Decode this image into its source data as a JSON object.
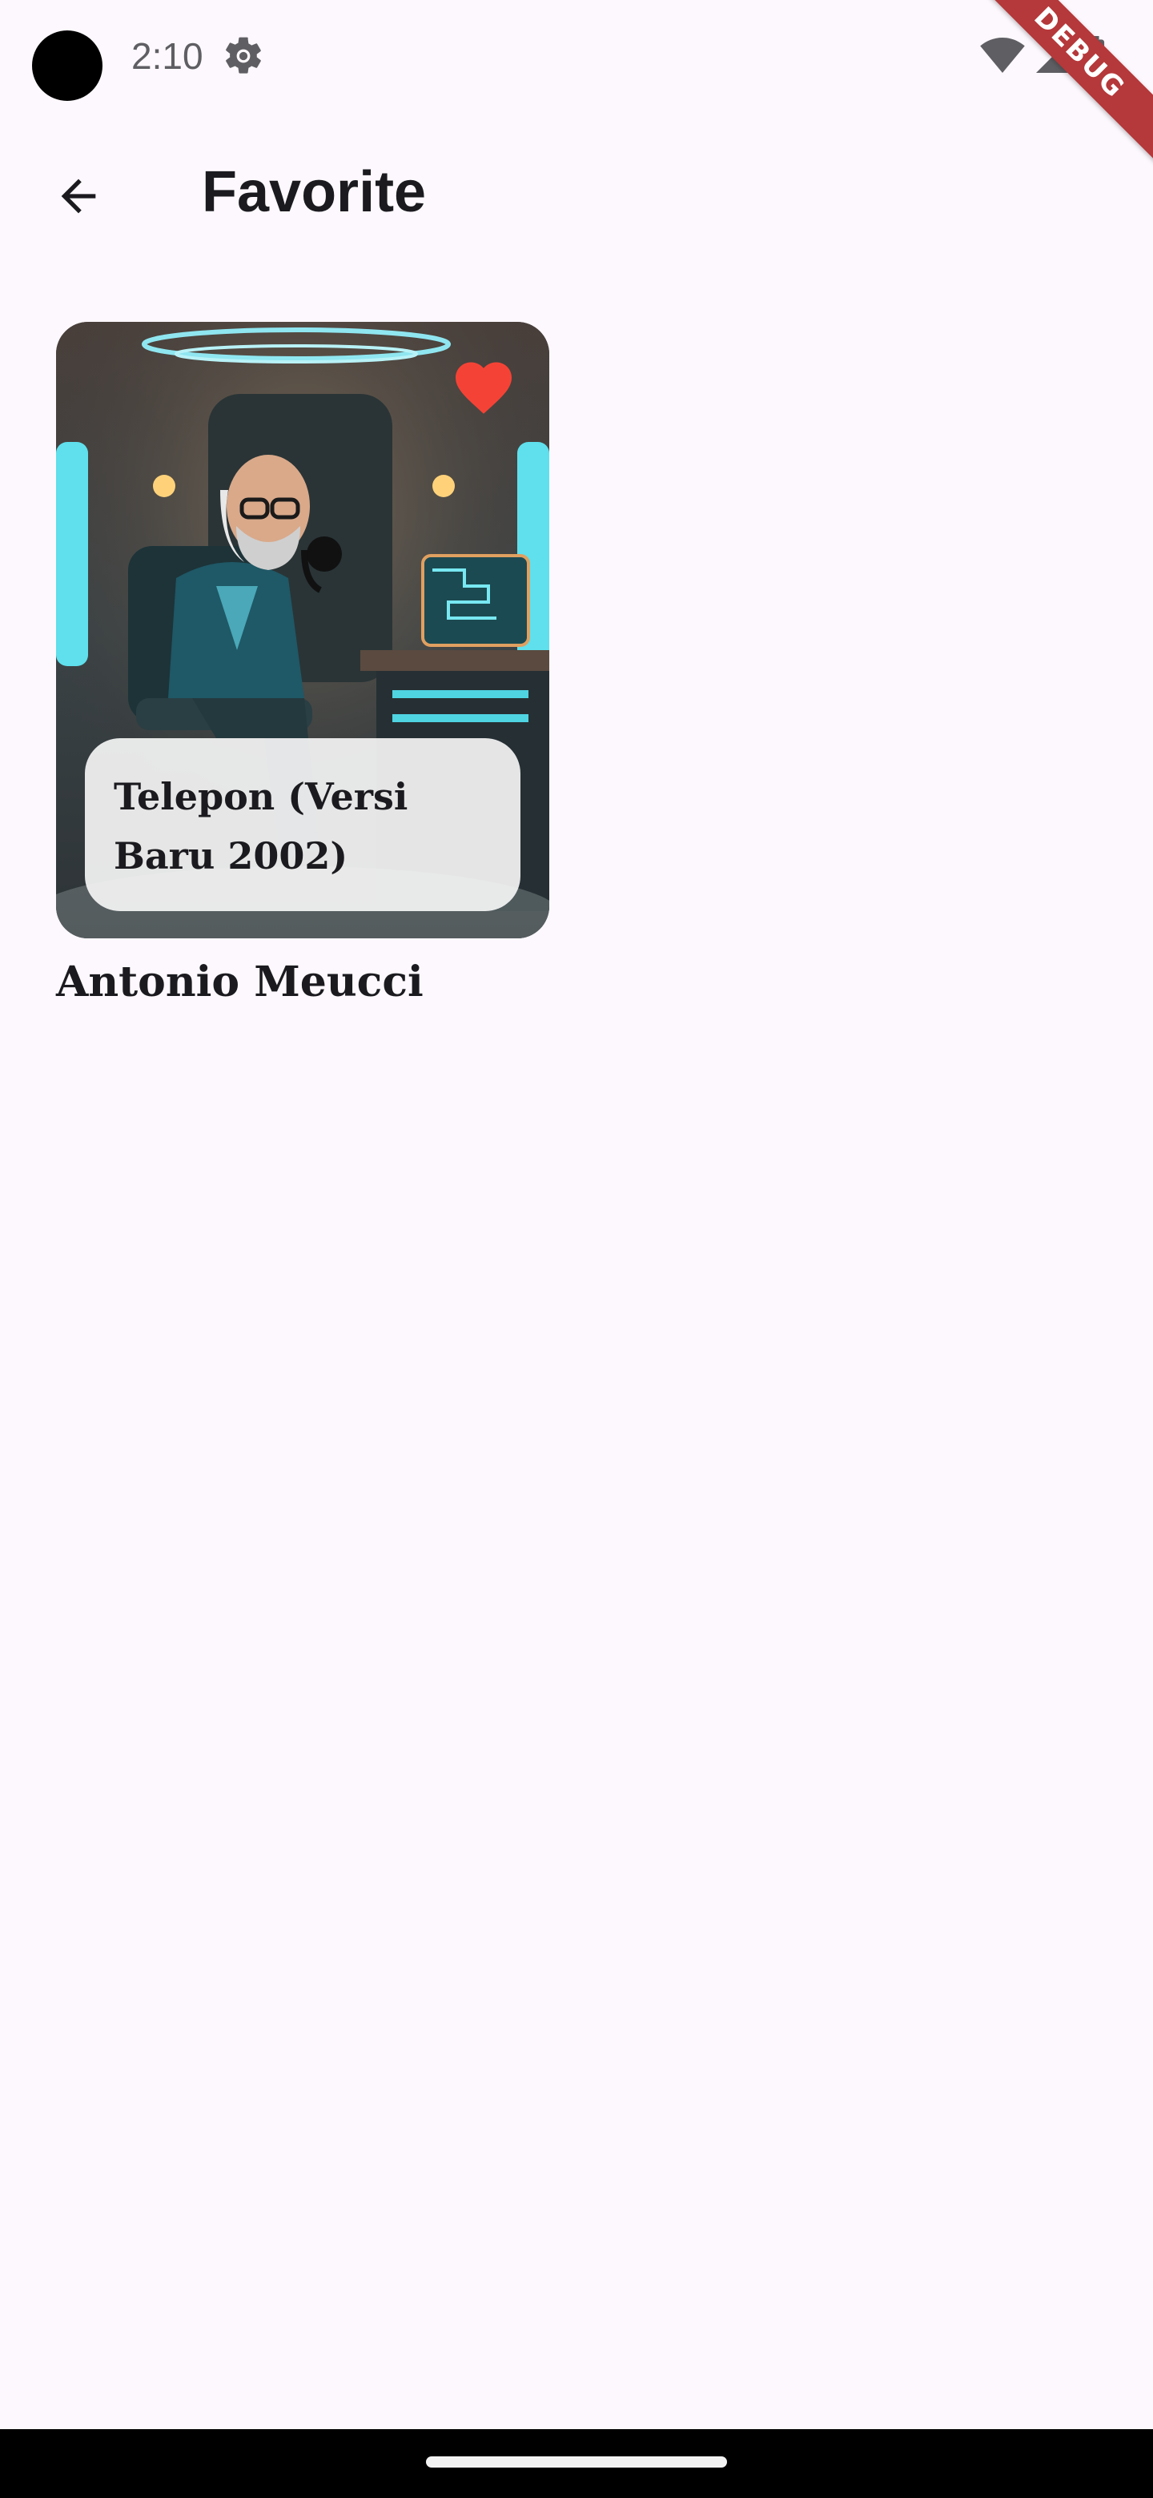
{
  "status_bar": {
    "time": "2:10",
    "icons": [
      "settings-gear-icon",
      "wifi-icon",
      "cellular-signal-icon",
      "battery-icon"
    ]
  },
  "debug_banner": {
    "label": "DEBUG"
  },
  "app_bar": {
    "back_icon": "arrow-back-icon",
    "title": "Favorite"
  },
  "favorites": [
    {
      "title": "Telepon (Versi Baru 2002)",
      "author": "Antonio Meucci",
      "is_favorite": true,
      "favorite_icon": "heart-icon",
      "favorite_color": "#f44336"
    }
  ],
  "colors": {
    "background": "#fdf8fd",
    "text": "#1b1b1f",
    "debug_banner": "#b5383a"
  }
}
